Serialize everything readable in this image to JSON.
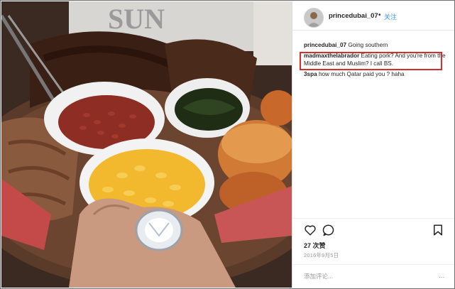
{
  "post": {
    "username": "princedubai_07",
    "separator": "•",
    "follow_label": "关注",
    "likes": "27 次赞",
    "date": "2016年9月5日",
    "add_comment_placeholder": "添加评论...",
    "more_label": "..."
  },
  "comments": [
    {
      "user": "princedubai_07",
      "text": "Going southern"
    },
    {
      "user": "madmaxthelabrador",
      "text": "Eating pork? And you're from the Middle East and Muslim? I call BS."
    },
    {
      "user": "3spa",
      "text": "how much Qatar paid you ? haha"
    }
  ],
  "highlight": {
    "color": "#d32f2f",
    "target": "comment-2"
  },
  "icons": [
    "heart-icon",
    "comment-icon",
    "bookmark-icon"
  ],
  "photo_overlay_text": "SUN"
}
